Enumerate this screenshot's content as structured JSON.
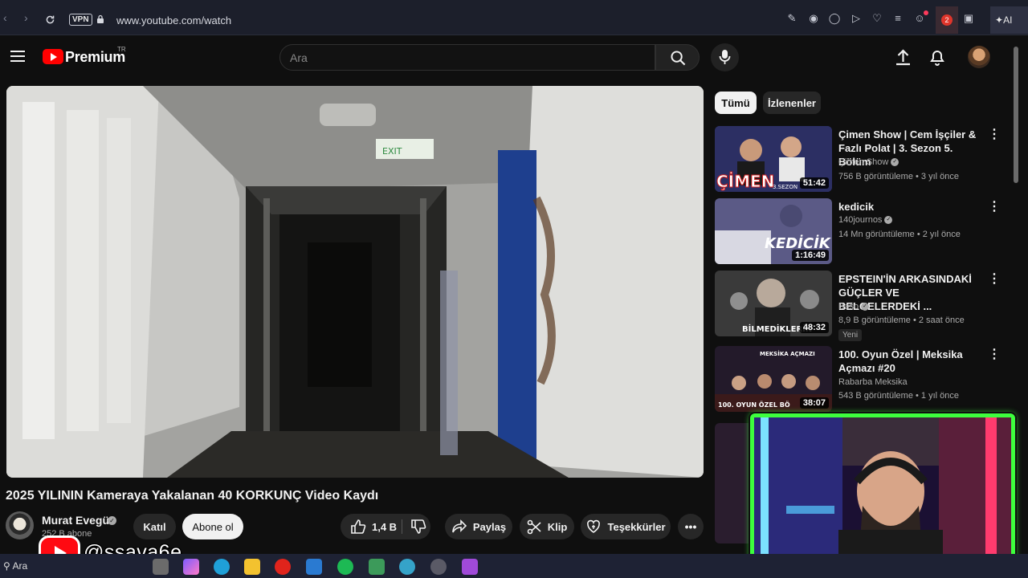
{
  "browser": {
    "url": "www.youtube.com/watch",
    "vpn_label": "VPN",
    "ai_label": "AI",
    "badge_count": "2"
  },
  "header": {
    "logo_text": "Premium",
    "region": "TR",
    "search_placeholder": "Ara"
  },
  "video": {
    "title": "2025 YILININ Kameraya Yakalanan 40 KORKUNÇ Video Kaydı",
    "exit_sign": "EXIT"
  },
  "channel": {
    "name": "Murat Evegü",
    "subscribers": "252 B abone",
    "join_label": "Katıl",
    "subscribe_label": "Abone ol"
  },
  "actions": {
    "likes": "1,4 B",
    "share": "Paylaş",
    "clip": "Klip",
    "thanks": "Teşekkürler"
  },
  "chips": [
    "Tümü",
    "İzlenenler"
  ],
  "recommendations": [
    {
      "title": "Çimen Show | Cem İşçiler & Fazlı Polat | 3. Sezon 5. Bölüm",
      "channel": "Çimen Show",
      "verified": true,
      "meta": "756 B görüntüleme • 3 yıl önce",
      "duration": "51:42",
      "thumb_text": "ÇİMEN",
      "thumb_sub": "3.SEZON",
      "thumb_color": "#2a3d8a"
    },
    {
      "title": "kedicik",
      "channel": "140journos",
      "verified": true,
      "meta": "14 Mn görüntüleme • 2 yıl önce",
      "duration": "1:16:49",
      "thumb_text": "KEDİCİK",
      "thumb_color": "#5b5a86"
    },
    {
      "title": "EPSTEIN'İN ARKASINDAKİ GÜÇLER VE BELGELERDEKİ ...",
      "channel": "Baso",
      "verified": true,
      "meta": "8,9 B görüntüleme • 2 saat önce",
      "badge": "Yeni",
      "duration": "48:32",
      "thumb_text": "BİLMEDİKLERİN",
      "thumb_color": "#3a3a3a"
    },
    {
      "title": "100. Oyun Özel | Meksika Açmazı #20",
      "channel": "Rabarba Meksika",
      "verified": false,
      "meta": "543 B görüntüleme • 1 yıl önce",
      "duration": "38:07",
      "thumb_text": "MEKSİKA AÇMAZI",
      "thumb_sub": "100. OYUN ÖZEL BÖ",
      "thumb_color": "#231a2a"
    }
  ],
  "overlay": {
    "handle": "@ssava6e"
  },
  "taskbar": {
    "search_label": "Ara"
  },
  "colors": {
    "accent": "#ff0000",
    "background": "#0f0f0f",
    "webcam_frame": "#3dff3d"
  }
}
